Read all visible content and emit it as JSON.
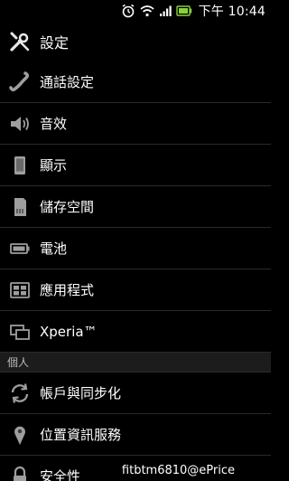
{
  "status_bar": {
    "time": "下午 10:44",
    "icons": [
      "alarm-icon",
      "wifi-icon",
      "signal-icon",
      "battery-icon"
    ]
  },
  "header": {
    "title": "設定",
    "icon": "wrench-screwdriver-icon"
  },
  "menu": {
    "items_top": [
      {
        "label": "通話設定",
        "icon": "phone-handset-icon"
      },
      {
        "label": "音效",
        "icon": "speaker-icon"
      },
      {
        "label": "顯示",
        "icon": "display-icon"
      },
      {
        "label": "儲存空間",
        "icon": "storage-icon"
      },
      {
        "label": "電池",
        "icon": "battery-icon"
      },
      {
        "label": "應用程式",
        "icon": "apps-icon"
      },
      {
        "label": "Xperia™",
        "icon": "xperia-icon"
      }
    ],
    "section_personal": "個人",
    "items_personal": [
      {
        "label": "帳戶與同步化",
        "icon": "sync-icon"
      },
      {
        "label": "位置資訊服務",
        "icon": "location-pin-icon"
      },
      {
        "label": "安全性",
        "icon": "lock-icon"
      }
    ]
  },
  "watermark": "fitbtm6810@ePrice"
}
